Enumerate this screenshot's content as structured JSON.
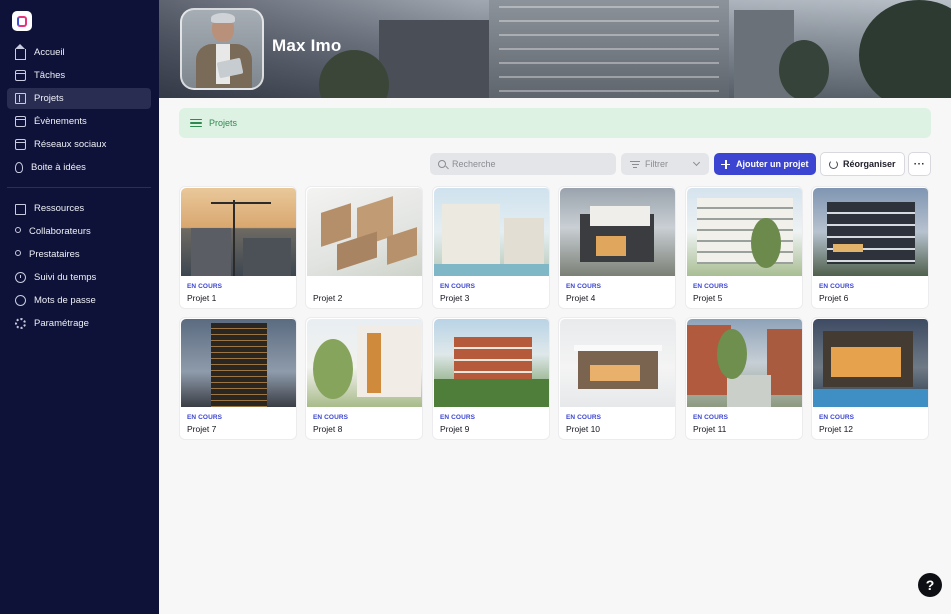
{
  "sidebar": {
    "items": [
      {
        "label": "Accueil",
        "icon": "home-icon"
      },
      {
        "label": "Tâches",
        "icon": "calendar-icon"
      },
      {
        "label": "Projets",
        "icon": "building-icon",
        "active": true
      },
      {
        "label": "Évènements",
        "icon": "calendar-icon"
      },
      {
        "label": "Réseaux sociaux",
        "icon": "calendar-icon"
      },
      {
        "label": "Boite à idées",
        "icon": "lightbulb-icon"
      }
    ],
    "items2": [
      {
        "label": "Ressources",
        "icon": "folder-icon"
      },
      {
        "label": "Collaborateurs",
        "icon": "users-icon"
      },
      {
        "label": "Prestataires",
        "icon": "users-icon"
      },
      {
        "label": "Suivi du temps",
        "icon": "clock-icon"
      },
      {
        "label": "Mots de passe",
        "icon": "check-circle-icon"
      },
      {
        "label": "Paramétrage",
        "icon": "gear-icon"
      }
    ]
  },
  "header": {
    "owner_name": "Max Imo"
  },
  "breadcrumb": {
    "label": "Projets"
  },
  "toolbar": {
    "search_placeholder": "Recherche",
    "filter_label": "Filtrer",
    "add_label": "Ajouter un projet",
    "reorganize_label": "Réorganiser",
    "more_label": "···"
  },
  "projects": [
    {
      "name": "Projet 1",
      "status": "EN COURS"
    },
    {
      "name": "Projet 2",
      "status": ""
    },
    {
      "name": "Projet 3",
      "status": "EN COURS"
    },
    {
      "name": "Projet 4",
      "status": "EN COURS"
    },
    {
      "name": "Projet 5",
      "status": "EN COURS"
    },
    {
      "name": "Projet 6",
      "status": "EN COURS"
    },
    {
      "name": "Projet 7",
      "status": "EN COURS"
    },
    {
      "name": "Projet 8",
      "status": "EN COURS"
    },
    {
      "name": "Projet 9",
      "status": "EN COURS"
    },
    {
      "name": "Projet 10",
      "status": "EN COURS"
    },
    {
      "name": "Projet 11",
      "status": "EN COURS"
    },
    {
      "name": "Projet 12",
      "status": "EN COURS"
    }
  ],
  "help": {
    "label": "?"
  },
  "colors": {
    "sidebar_bg": "#0f1238",
    "accent": "#3b45d1",
    "breadcrumb_bg": "#def2e4",
    "breadcrumb_text": "#2e8a4f"
  }
}
